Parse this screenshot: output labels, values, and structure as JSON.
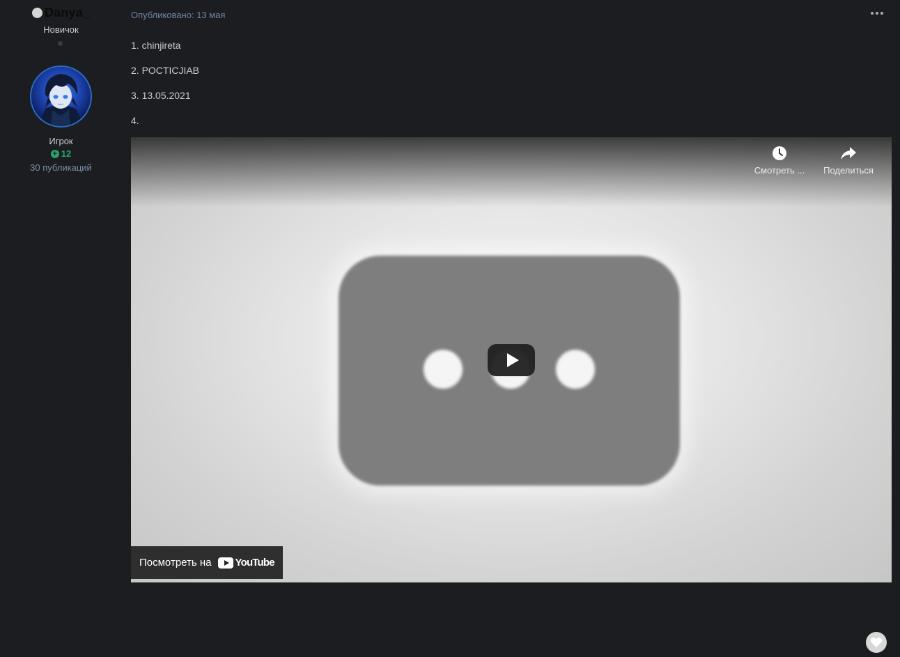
{
  "author": {
    "name": "Danya_",
    "group": "Новичок",
    "rank": "Игрок",
    "reputation": "12",
    "posts": "30 публикаций"
  },
  "post": {
    "date": "Опубликовано: 13 мая",
    "lines": [
      "1. chinjireta",
      "2. POCTICJIAB",
      "3. 13.05.2021",
      "4."
    ]
  },
  "video": {
    "watch_later": "Смотреть ...",
    "share": "Поделиться",
    "watch_on": "Посмотреть на",
    "brand": "YouTube"
  },
  "icons": {
    "status": "offline-status-dot",
    "reputation": "plus-circle-icon",
    "more": "ellipsis-icon",
    "watch_later": "clock-icon",
    "share": "share-arrow-icon",
    "play": "play-icon",
    "react": "heart-icon"
  },
  "colors": {
    "background": "#1c1d21",
    "reputation_green": "#28a46d",
    "meta_blue": "#6f86a3"
  }
}
